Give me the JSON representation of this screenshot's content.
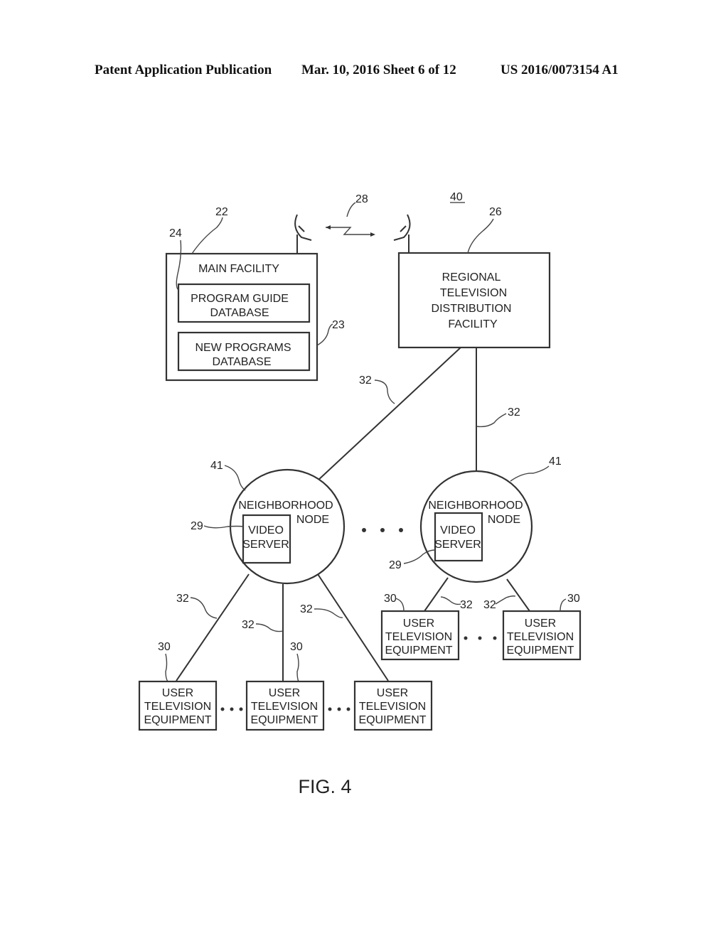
{
  "header": {
    "left": "Patent Application Publication",
    "middle": "Mar. 10, 2016  Sheet 6 of 12",
    "right": "US 2016/0073154 A1"
  },
  "figure": {
    "caption": "FIG. 4",
    "system_ref": "40",
    "wireless_link_ref": "28",
    "main_facility": {
      "ref": "22",
      "title": "MAIN FACILITY",
      "program_guide_db": {
        "ref": "24",
        "line1": "PROGRAM GUIDE",
        "line2": "DATABASE"
      },
      "new_programs_db": {
        "ref": "23",
        "line1": "NEW PROGRAMS",
        "line2": "DATABASE"
      }
    },
    "regional_facility": {
      "ref": "26",
      "lines": [
        "REGIONAL",
        "TELEVISION",
        "DISTRIBUTION",
        "FACILITY"
      ]
    },
    "link_ref": "32",
    "neighborhood_nodes": [
      {
        "ref": "41",
        "line1": "NEIGHBORHOOD",
        "line2": "NODE",
        "server_ref": "29",
        "server_line1": "VIDEO",
        "server_line2": "SERVER"
      },
      {
        "ref": "41",
        "line1": "NEIGHBORHOOD",
        "line2": "NODE",
        "server_ref": "29",
        "server_line1": "VIDEO",
        "server_line2": "SERVER"
      }
    ],
    "user_equipment": {
      "ref": "30",
      "line1": "USER",
      "line2": "TELEVISION",
      "line3": "EQUIPMENT"
    },
    "ellipsis": "•  •  •"
  }
}
